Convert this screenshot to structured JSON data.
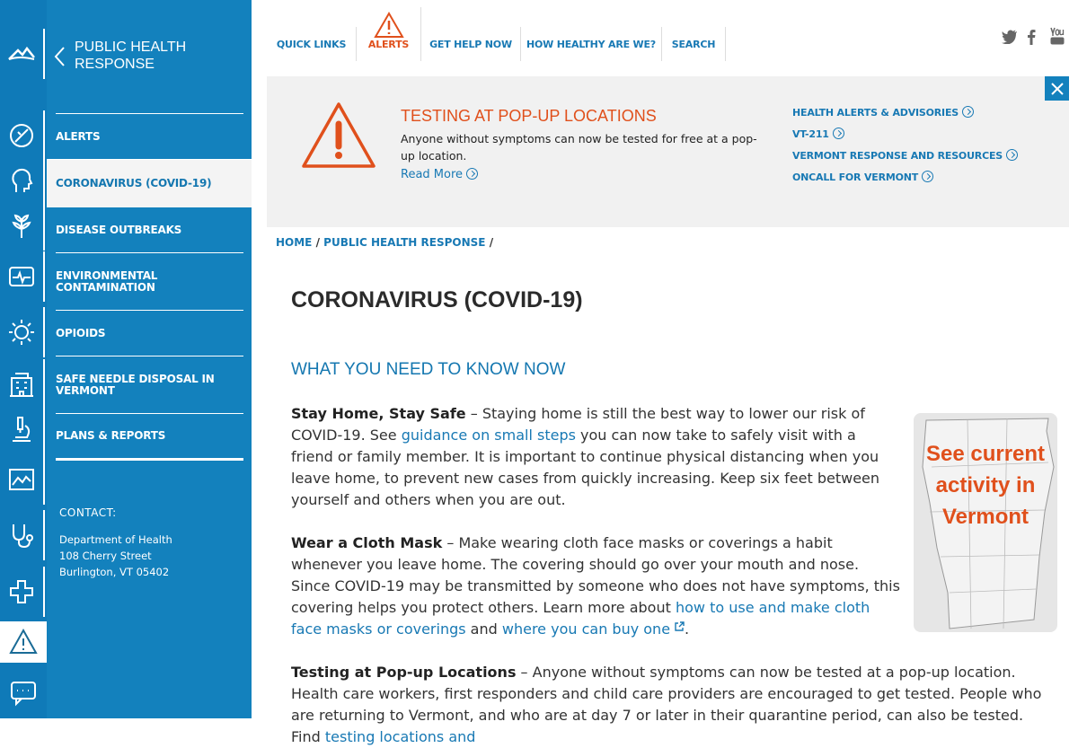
{
  "sidebar": {
    "title": "PUBLIC HEALTH RESPONSE",
    "items": [
      {
        "label": "ALERTS"
      },
      {
        "label": "CORONAVIRUS (COVID-19)"
      },
      {
        "label": "DISEASE OUTBREAKS"
      },
      {
        "label": "ENVIRONMENTAL CONTAMINATION"
      },
      {
        "label": "OPIOIDS"
      },
      {
        "label": "SAFE NEEDLE DISPOSAL IN VERMONT"
      },
      {
        "label": "PLANS & REPORTS"
      }
    ],
    "contact": {
      "label": "CONTACT:",
      "lines": [
        "Department of Health",
        "108 Cherry Street",
        "Burlington, VT 05402"
      ]
    }
  },
  "nav": {
    "items": [
      "QUICK LINKS",
      "ALERTS",
      "GET HELP NOW",
      "HOW HEALTHY ARE WE?",
      "SEARCH"
    ]
  },
  "alert": {
    "title": "TESTING AT POP-UP LOCATIONS",
    "text": "Anyone without symptoms can now be tested for free at a pop-up location.",
    "read_more": "Read More",
    "links": [
      "HEALTH ALERTS & ADVISORIES",
      "VT-211",
      "VERMONT RESPONSE AND RESOURCES",
      "ONCALL FOR VERMONT"
    ]
  },
  "breadcrumb": {
    "home": "HOME",
    "parent": "PUBLIC HEALTH RESPONSE",
    "sep": "/"
  },
  "page": {
    "title": "CORONAVIRUS (COVID-19)",
    "section": "WHAT YOU NEED TO KNOW NOW",
    "map_text": "See current activity in Vermont",
    "p1": {
      "bold": "Stay Home, Stay Safe",
      "t1": " – Staying home is still the best way to lower our risk of COVID-19. See ",
      "link": "guidance on small steps",
      "t2": " you can now take to safely visit with a friend or family member. It is important to continue physical distancing when you leave home, to prevent new cases from quickly increasing. Keep six feet between yourself and others when you are out."
    },
    "p2": {
      "bold": "Wear a Cloth Mask",
      "t1": " – Make wearing cloth face masks or coverings a habit whenever you leave home. The covering should go over your mouth and nose. Since COVID-19 may be transmitted by someone who does not have symptoms, this covering helps you protect others. Learn more about ",
      "link1": "how to use and make cloth face masks or coverings",
      "t2": " and ",
      "link2": "where you can buy one",
      "t3": "."
    },
    "p3": {
      "bold": "Testing at Pop-up Locations",
      "t1": " – Anyone without symptoms can now be tested at a pop-up location. Health care workers, first responders and child care providers are encouraged to get tested. People who are returning to Vermont, and who are at day 7 or later in their quarantine period, can also be tested. Find ",
      "link": "testing locations and"
    }
  },
  "colors": {
    "brand_blue": "#1381bd",
    "alert_orange": "#e0501c",
    "link_blue": "#1879b4"
  }
}
